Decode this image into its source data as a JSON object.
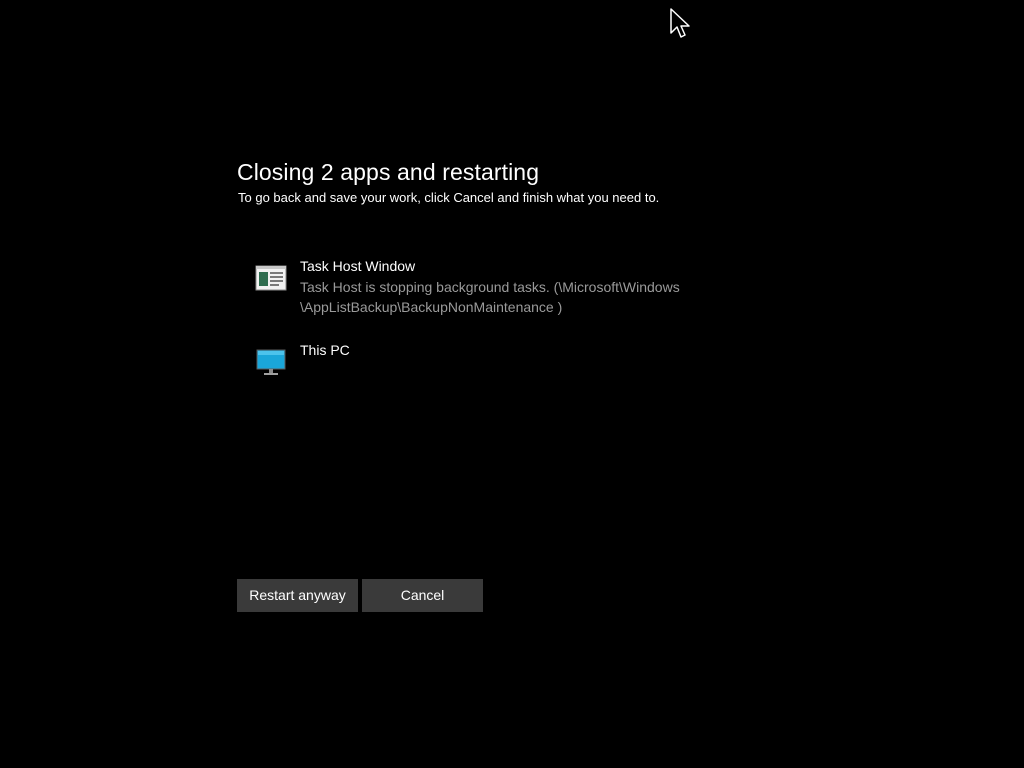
{
  "dialog": {
    "title": "Closing 2 apps and restarting",
    "subtitle": "To go back and save your work, click Cancel and finish what you need to."
  },
  "apps": [
    {
      "name": "Task Host Window",
      "description_line1": "Task Host is stopping background tasks. (\\Microsoft\\Windows",
      "description_line2": "\\AppListBackup\\BackupNonMaintenance )",
      "icon": "task-host-window-icon"
    },
    {
      "name": "This PC",
      "icon": "monitor-icon"
    }
  ],
  "buttons": {
    "restart_label": "Restart anyway",
    "cancel_label": "Cancel"
  },
  "colors": {
    "background": "#000000",
    "text": "#ffffff",
    "secondary_text": "#9a9a9a",
    "button_background": "#3a3a3a",
    "monitor_accent": "#1aa6d9"
  }
}
